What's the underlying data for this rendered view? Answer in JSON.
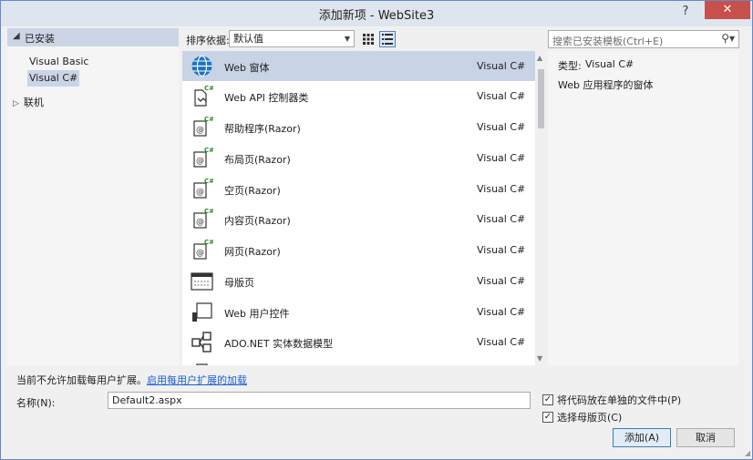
{
  "window": {
    "title": "添加新项 - WebSite3",
    "help": "?",
    "close": "✕"
  },
  "tree": {
    "header": "已安装",
    "items": [
      "Visual Basic",
      "Visual C#"
    ],
    "selected": "Visual C#",
    "online": "联机"
  },
  "toolbar": {
    "sort_label": "排序依据:",
    "sort_value": "默认值",
    "views": [
      "grid-view",
      "list-view"
    ],
    "active_view": "list-view"
  },
  "search": {
    "placeholder": "搜索已安装模板(Ctrl+E)"
  },
  "templates": [
    {
      "name": "Web 窗体",
      "lang": "Visual C#",
      "icon": "globe-icon",
      "selected": true
    },
    {
      "name": "Web API 控制器类",
      "lang": "Visual C#",
      "icon": "webapi-controller-icon"
    },
    {
      "name": "帮助程序(Razor)",
      "lang": "Visual C#",
      "icon": "razor-icon"
    },
    {
      "name": "布局页(Razor)",
      "lang": "Visual C#",
      "icon": "razor-icon"
    },
    {
      "name": "空页(Razor)",
      "lang": "Visual C#",
      "icon": "razor-icon"
    },
    {
      "name": "内容页(Razor)",
      "lang": "Visual C#",
      "icon": "razor-icon"
    },
    {
      "name": "网页(Razor)",
      "lang": "Visual C#",
      "icon": "razor-icon"
    },
    {
      "name": "母版页",
      "lang": "Visual C#",
      "icon": "master-page-icon"
    },
    {
      "name": "Web 用户控件",
      "lang": "Visual C#",
      "icon": "user-control-icon"
    },
    {
      "name": "ADO.NET 实体数据模型",
      "lang": "Visual C#",
      "icon": "entity-model-icon"
    }
  ],
  "info": {
    "type_key": "类型:",
    "type_value": "Visual C#",
    "description": "Web 应用程序的窗体"
  },
  "bottom": {
    "notice": "当前不允许加载每用户扩展。",
    "notice_link": "启用每用户扩展的加载",
    "name_label": "名称(N):",
    "name_value": "Default2.aspx",
    "checkbox_separate": "将代码放在单独的文件中(P)",
    "checkbox_separate_checked": true,
    "checkbox_master": "选择母版页(C)",
    "checkbox_master_checked": true,
    "add_button": "添加(A)",
    "cancel_button": "取消"
  },
  "colors": {
    "selection": "#c9d3e6",
    "close": "#c7504b",
    "link": "#1c5fd6",
    "titlebar": "#dfe5ef"
  }
}
